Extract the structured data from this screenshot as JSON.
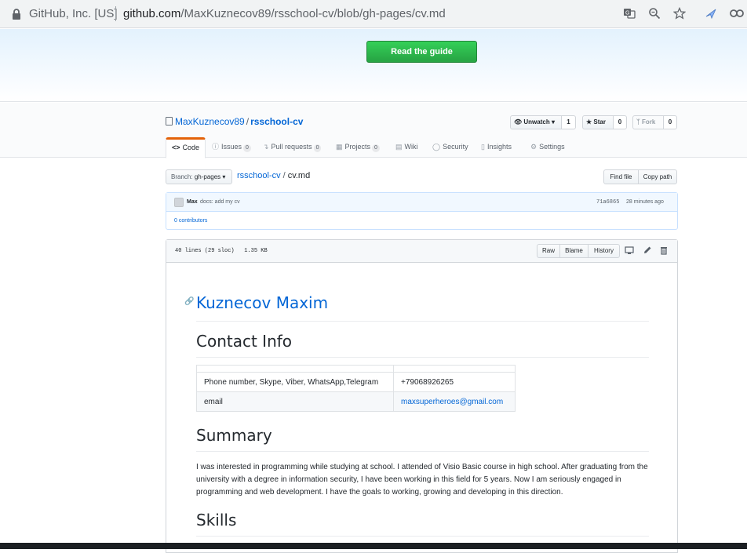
{
  "browser": {
    "site_identity": "GitHub, Inc. [US]",
    "url_host": "github.com",
    "url_path": "/MaxKuznecov89/rsschool-cv/blob/gh-pages/cv.md",
    "icons": [
      "lock-icon",
      "translate-icon",
      "zoom-icon",
      "star-icon",
      "extension-icon"
    ]
  },
  "banner": {
    "button_label": "Read the guide"
  },
  "repo": {
    "owner": "MaxKuznecov89",
    "separator": "/",
    "name": "rsschool-cv",
    "unwatch_label": "Unwatch",
    "unwatch_count": "1",
    "star_label": "Star",
    "star_count": "0",
    "fork_label": "Fork",
    "fork_count": "0",
    "tabs": [
      {
        "label": "Code"
      },
      {
        "label": "Issues",
        "count": "0"
      },
      {
        "label": "Pull requests",
        "count": "0"
      },
      {
        "label": "Projects",
        "count": "0"
      },
      {
        "label": "Wiki"
      },
      {
        "label": "Security"
      },
      {
        "label": "Insights"
      },
      {
        "label": "Settings"
      }
    ]
  },
  "filenav": {
    "branch_prefix": "Branch:",
    "branch_name": "gh-pages",
    "crumb_repo": "rsschool-cv",
    "crumb_sep": "/",
    "crumb_file": "cv.md",
    "find_file": "Find file",
    "copy_path": "Copy path"
  },
  "commit": {
    "author": "Max",
    "message": "docs: add my cv",
    "sha": "71a6865",
    "time": "28 minutes ago",
    "contributors": "0 contributors"
  },
  "file": {
    "info_lines": "40 lines (29 sloc)",
    "info_size": "1.35 KB",
    "raw": "Raw",
    "blame": "Blame",
    "history": "History"
  },
  "markdown": {
    "title": "Kuznecov Maxim",
    "contact_heading": "Contact Info",
    "contacts": [
      {
        "label": "Phone number, Skype, Viber, WhatsApp,Telegram",
        "value": "+79068926265"
      },
      {
        "label": "email",
        "value": "maxsuperheroes@gmail.com"
      }
    ],
    "summary_heading": "Summary",
    "summary_text": "I was interested in programming while studying at school. I attended of Visio Basic course in high school. After graduating from the university with a degree in information security, I have been working in this field for 5 years. Now I am seriously engaged in programming and web development. I have the goals to working, growing and developing in this direction.",
    "skills_heading": "Skills"
  }
}
